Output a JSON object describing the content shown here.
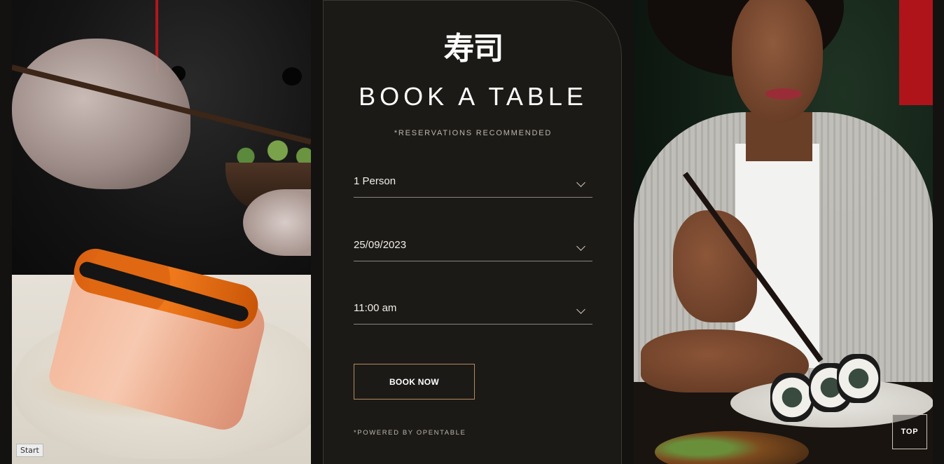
{
  "brand": {
    "logo_text": "寿司"
  },
  "booking": {
    "title": "BOOK A TABLE",
    "subtitle": "*RESERVATIONS RECOMMENDED",
    "party_size": "1 Person",
    "date": "25/09/2023",
    "time": "11:00 am",
    "submit_label": "BOOK NOW",
    "powered_by": "*POWERED BY OPENTABLE"
  },
  "nav": {
    "top_label": "TOP"
  },
  "start_badge": "Start",
  "colors": {
    "background": "#141210",
    "panel": "#1c1a17",
    "accent_border": "#b58c5f",
    "text_primary": "#ffffff",
    "text_muted": "#bdb7ab"
  },
  "icons": {
    "field_dropdown": "chevron-down-icon"
  }
}
